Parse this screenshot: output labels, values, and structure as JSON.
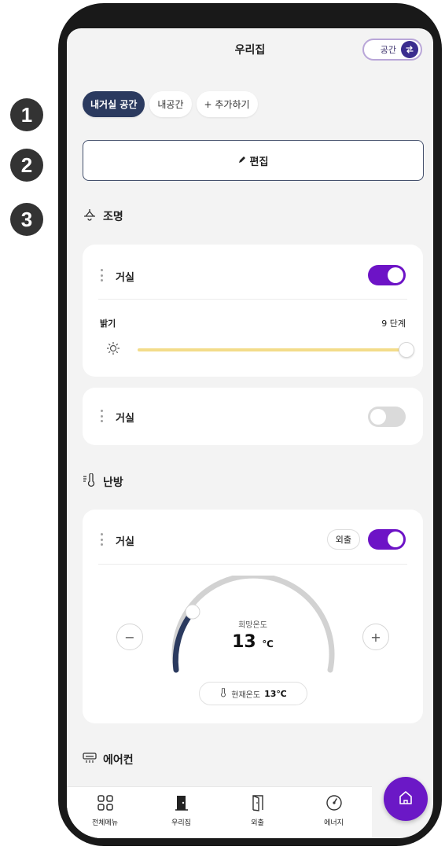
{
  "markers": [
    "1",
    "2",
    "3"
  ],
  "header": {
    "title": "우리집",
    "space_label": "공간"
  },
  "tabs": [
    {
      "label": "내거실 공간",
      "active": true
    },
    {
      "label": "내공간",
      "active": false
    },
    {
      "label": "+ 추가하기",
      "active": false
    }
  ],
  "edit_label": "편집",
  "lighting": {
    "title": "조명",
    "devices": [
      {
        "name": "거실",
        "on": true,
        "brightness_label": "밝기",
        "brightness_value": "9 단계",
        "brightness_level": 1.0
      },
      {
        "name": "거실",
        "on": false
      }
    ]
  },
  "heating": {
    "title": "난방",
    "device": {
      "name": "거실",
      "away_label": "외출",
      "on": true,
      "target_label": "희망온도",
      "target_value": "13",
      "unit": "℃",
      "current_label": "현재온도",
      "current_value": "13℃",
      "minus": "−",
      "plus": "+"
    }
  },
  "aircon": {
    "title": "에어컨"
  },
  "bottom_nav": [
    {
      "label": "전체메뉴",
      "icon": "grid-icon"
    },
    {
      "label": "우리집",
      "icon": "door-icon"
    },
    {
      "label": "외출",
      "icon": "door-open-icon"
    },
    {
      "label": "에너지",
      "icon": "gauge-icon"
    }
  ],
  "colors": {
    "accent": "#6d13c6",
    "tab_active": "#2b3a5f",
    "slider": "#f3dc8a",
    "gauge_active": "#2b3a5f"
  }
}
